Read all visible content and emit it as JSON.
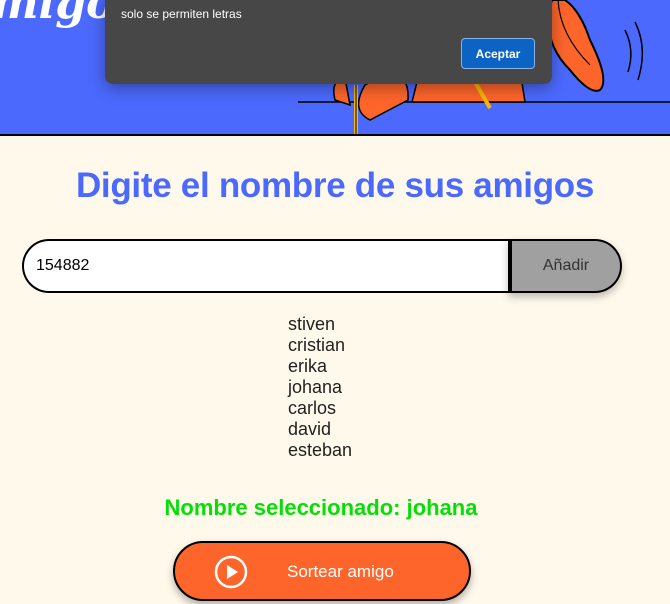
{
  "header": {
    "title": "migo S",
    "background_color": "#4b69fd"
  },
  "alert": {
    "message": "solo se permiten letras",
    "accept_label": "Aceptar"
  },
  "main": {
    "title": "Digite el nombre de sus amigos",
    "input": {
      "value": "154882",
      "placeholder": ""
    },
    "add_label": "Añadir",
    "friends": [
      "stiven",
      "cristian",
      "erika",
      "johana",
      "carlos",
      "david",
      "esteban"
    ],
    "result_text": "Nombre seleccionado: johana",
    "draw_label": "Sortear amigo",
    "draw_icon": "play-circle-icon"
  },
  "colors": {
    "accent_blue": "#4b69fd",
    "button_orange": "#fe652b",
    "result_green": "#05df05",
    "background": "#fff9eb"
  }
}
